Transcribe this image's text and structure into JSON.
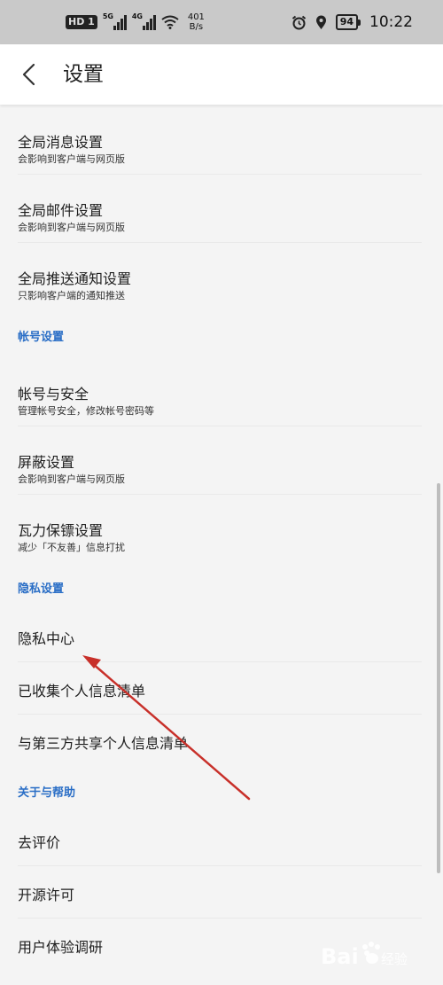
{
  "status_bar": {
    "hd_badge": "HD 1",
    "signal_1_label": "5G",
    "signal_2_label": "4G",
    "net_speed_value": "401",
    "net_speed_unit": "B/s",
    "battery_level": "94",
    "time": "10:22"
  },
  "header": {
    "title": "设置"
  },
  "list": {
    "global_message": {
      "title": "全局消息设置",
      "subtitle": "会影响到客户端与网页版"
    },
    "global_mail": {
      "title": "全局邮件设置",
      "subtitle": "会影响到客户端与网页版"
    },
    "global_push": {
      "title": "全局推送通知设置",
      "subtitle": "只影响客户端的通知推送"
    },
    "account_section": "帐号设置",
    "account_security": {
      "title": "帐号与安全",
      "subtitle": "管理帐号安全，修改帐号密码等"
    },
    "block_settings": {
      "title": "屏蔽设置",
      "subtitle": "会影响到客户端与网页版"
    },
    "bodyguard": {
      "title": "瓦力保镖设置",
      "subtitle": "减少「不友善」信息打扰"
    },
    "privacy_section": "隐私设置",
    "privacy_center": "隐私中心",
    "collected_info": "已收集个人信息清单",
    "third_party_info": "与第三方共享个人信息清单",
    "about_section": "关于与帮助",
    "rate": "去评价",
    "open_source": "开源许可",
    "user_research": "用户体验调研"
  },
  "colors": {
    "section_title": "#2a6ec6",
    "annotation_arrow": "#c8302a",
    "status_bar_bg": "#c9c9c9"
  },
  "icons": {
    "back": "back-arrow-icon",
    "wifi": "wifi-icon",
    "alarm": "alarm-clock-icon",
    "location": "location-pin-icon"
  }
}
